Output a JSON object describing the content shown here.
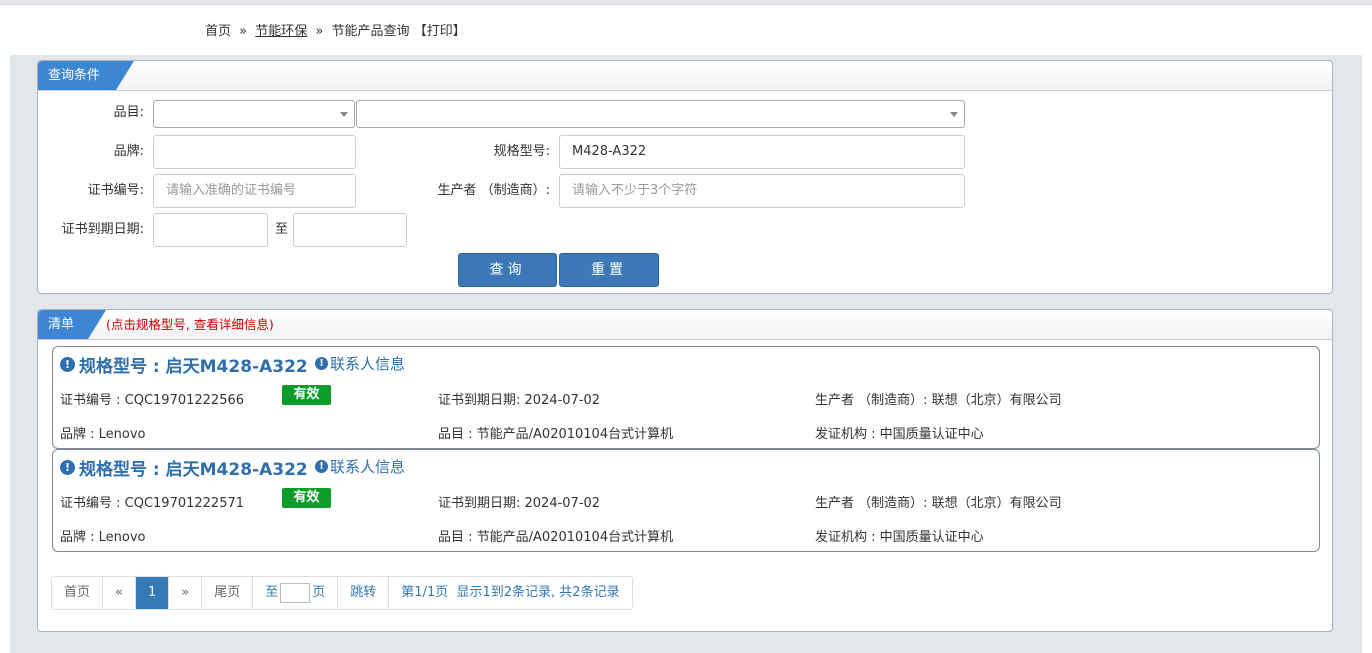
{
  "breadcrumb": {
    "home": "首页",
    "sep1": "»",
    "section": "节能环保",
    "sep2": "»",
    "current": "节能产品查询",
    "print": "【打印】"
  },
  "query_panel": {
    "title": "查询条件",
    "labels": {
      "category": "品目:",
      "brand": "品牌:",
      "model": "规格型号:",
      "cert_no": "证书编号:",
      "producer": "生产者 （制造商）:",
      "expiry": "证书到期日期:",
      "to": "至"
    },
    "values": {
      "category1": "",
      "category2": "",
      "brand": "",
      "model": "M428-A322",
      "cert_no": "",
      "producer": "",
      "date_from": "",
      "date_to": ""
    },
    "placeholders": {
      "cert_no": "请输入准确的证书编号",
      "producer": "请输入不少于3个字符"
    },
    "buttons": {
      "search": "查询",
      "reset": "重置"
    }
  },
  "list_panel": {
    "title": "清单",
    "hint": "(点击规格型号, 查看详细信息)",
    "contact_label": "联系人信息",
    "items": [
      {
        "title": "规格型号 : 启天M428-A322",
        "cert": "证书编号 : CQC19701222566",
        "status": "有效",
        "expiry": "证书到期日期: 2024-07-02",
        "producer": "生产者 （制造商）: 联想（北京）有限公司",
        "brand": "品牌 : Lenovo",
        "category": "品目 : 节能产品/A02010104台式计算机",
        "issuer": "发证机构 : 中国质量认证中心"
      },
      {
        "title": "规格型号 : 启天M428-A322",
        "cert": "证书编号 : CQC19701222571",
        "status": "有效",
        "expiry": "证书到期日期: 2024-07-02",
        "producer": "生产者 （制造商）: 联想（北京）有限公司",
        "brand": "品牌 : Lenovo",
        "category": "品目 : 节能产品/A02010104台式计算机",
        "issuer": "发证机构 : 中国质量认证中心"
      }
    ],
    "pagination": {
      "first": "首页",
      "prev": "«",
      "current": "1",
      "next": "»",
      "last": "尾页",
      "goto_prefix": "至",
      "goto_suffix": "页",
      "jump": "跳转",
      "page_info": "第1/1页",
      "summary": "显示1到2条记录, 共2条记录"
    }
  },
  "colors": {
    "primary": "#3b78b5",
    "badge_valid": "#0d9c2a",
    "hint": "#d00000",
    "tag": "#3c86d3"
  }
}
